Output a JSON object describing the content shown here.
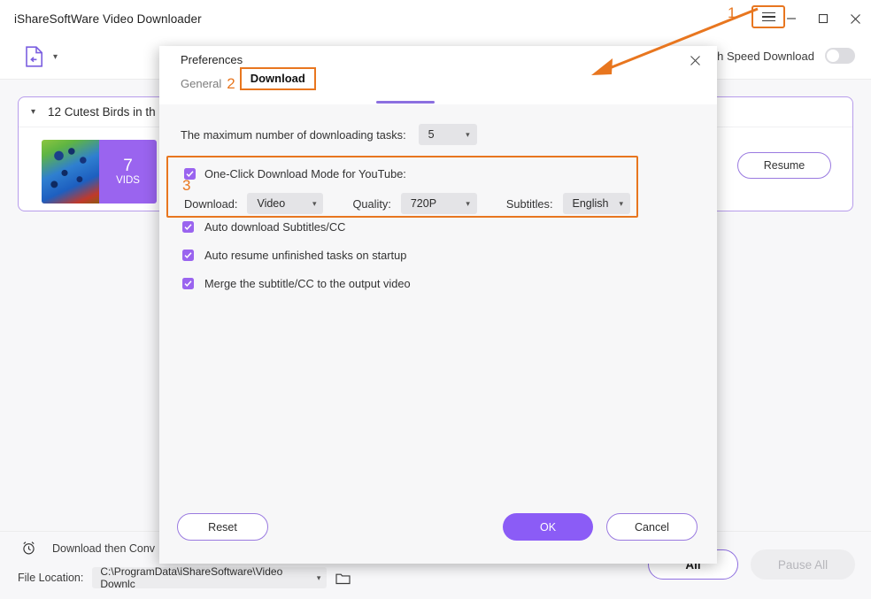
{
  "window": {
    "title": "iShareSoftWare Video Downloader",
    "controls": {
      "minimize": "minimize-icon",
      "maximize": "maximize-icon",
      "close": "close-icon",
      "menu": "hamburger-menu-icon"
    }
  },
  "annotations": {
    "step1": "1",
    "step2": "2",
    "step3": "3"
  },
  "toolbar": {
    "add_file_icon": "add-file-icon",
    "dropdown_icon": "chevron-down-icon",
    "high_speed_label": "High Speed Download",
    "high_speed_state": "off"
  },
  "task": {
    "title": "12 Cutest Birds in th",
    "count": "7",
    "count_unit": "VIDS",
    "resume_label": "Resume",
    "expand_icon": "chevron-down-icon"
  },
  "status_bar": {
    "alarm_icon": "alarm-clock-icon",
    "download_then_convert": "Download then Conv",
    "file_location_label": "File Location:",
    "file_location_value": "C:\\ProgramData\\iShareSoftware\\Video Downlc",
    "folder_icon": "folder-icon",
    "dropdown_icon": "chevron-down-icon",
    "start_all_label": "All",
    "pause_all_label": "Pause All"
  },
  "dialog": {
    "title": "Preferences",
    "close_icon": "close-icon",
    "tabs": [
      {
        "label": "General",
        "active": false
      },
      {
        "label": "Download",
        "active": true
      }
    ],
    "max_tasks": {
      "label": "The maximum number of downloading tasks:",
      "value": "5"
    },
    "one_click": {
      "label": "One-Click Download Mode for YouTube:",
      "checked": true,
      "download": {
        "label": "Download:",
        "value": "Video"
      },
      "quality": {
        "label": "Quality:",
        "value": "720P"
      },
      "subtitles": {
        "label": "Subtitles:",
        "value": "English"
      }
    },
    "options": [
      {
        "label": "Auto download Subtitles/CC",
        "checked": true
      },
      {
        "label": "Auto resume unfinished tasks on startup",
        "checked": true
      },
      {
        "label": "Merge the subtitle/CC to the output video",
        "checked": true
      }
    ],
    "buttons": {
      "reset": "Reset",
      "ok": "OK",
      "cancel": "Cancel"
    }
  },
  "colors": {
    "accent_purple": "#8b5cf6",
    "annotation_orange": "#e8761f",
    "thumb_purple": "#9a64ef",
    "window_bg": "#f7f7f9"
  }
}
